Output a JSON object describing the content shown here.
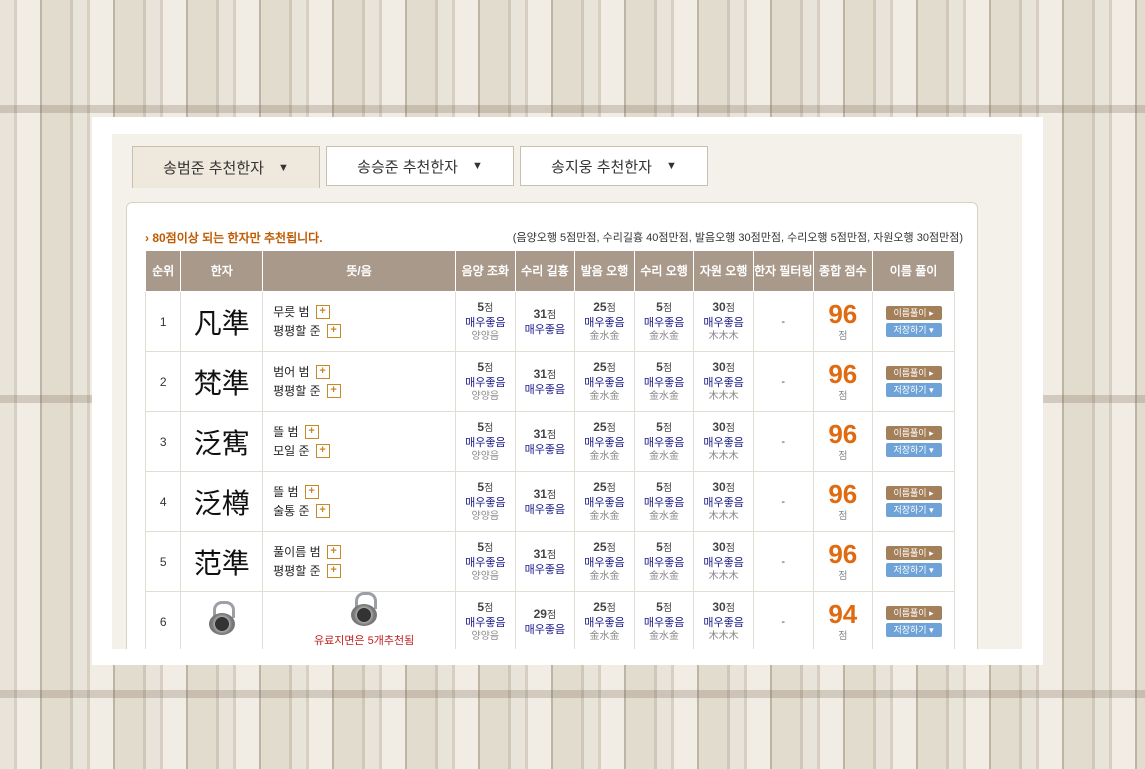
{
  "tabs": [
    {
      "label": "송범준 추천한자",
      "active": true
    },
    {
      "label": "송승준 추천한자",
      "active": false
    },
    {
      "label": "송지웅 추천한자",
      "active": false
    }
  ],
  "note": "› 80점이상 되는 한자만 추천됩니다.",
  "legend": "(음양오행 5점만점, 수리길흉 40점만점, 발음오행 30점만점, 수리오행 5점만점, 자원오행 30점만점)",
  "headers": {
    "rank": "순위",
    "hanja": "한자",
    "meaning": "뜻/음",
    "h1": "음양 조화",
    "h2": "수리 길흉",
    "h3": "발음 오행",
    "h4": "수리 오행",
    "h5": "자원 오행",
    "h6": "한자 필터링",
    "h7": "종합 점수",
    "h8": "이름 풀이"
  },
  "unit": "점",
  "grade": "매우좋음",
  "btn_interpret": "이름풀이 ▸",
  "btn_save": "저장하기 ▾",
  "rows": [
    {
      "rank": "1",
      "hanja": "凡準",
      "m1": "무릇 범",
      "m2": "평평할 준",
      "s1": "5",
      "s1sub": "양양음",
      "s2": "31",
      "s3": "25",
      "s3sub": "金水金",
      "s4": "5",
      "s4sub": "金水金",
      "s5": "30",
      "s5sub": "木木木",
      "filter": "-",
      "total": "96"
    },
    {
      "rank": "2",
      "hanja": "梵準",
      "m1": "범어 범",
      "m2": "평평할 준",
      "s1": "5",
      "s1sub": "양양음",
      "s2": "31",
      "s3": "25",
      "s3sub": "金水金",
      "s4": "5",
      "s4sub": "金水金",
      "s5": "30",
      "s5sub": "木木木",
      "filter": "-",
      "total": "96"
    },
    {
      "rank": "3",
      "hanja": "泛寯",
      "m1": "뜰 범",
      "m2": "모일 준",
      "s1": "5",
      "s1sub": "양양음",
      "s2": "31",
      "s3": "25",
      "s3sub": "金水金",
      "s4": "5",
      "s4sub": "金水金",
      "s5": "30",
      "s5sub": "木木木",
      "filter": "-",
      "total": "96"
    },
    {
      "rank": "4",
      "hanja": "泛樽",
      "m1": "뜰 범",
      "m2": "술통 준",
      "s1": "5",
      "s1sub": "양양음",
      "s2": "31",
      "s3": "25",
      "s3sub": "金水金",
      "s4": "5",
      "s4sub": "金水金",
      "s5": "30",
      "s5sub": "木木木",
      "filter": "-",
      "total": "96"
    },
    {
      "rank": "5",
      "hanja": "范準",
      "m1": "풀이름 범",
      "m2": "평평할 준",
      "s1": "5",
      "s1sub": "양양음",
      "s2": "31",
      "s3": "25",
      "s3sub": "金水金",
      "s4": "5",
      "s4sub": "金水金",
      "s5": "30",
      "s5sub": "木木木",
      "filter": "-",
      "total": "96"
    },
    {
      "rank": "6",
      "hanja": "",
      "m1": "",
      "m2": "",
      "locked": "유료지면은 5개추천됨",
      "s1": "5",
      "s1sub": "양양음",
      "s2": "29",
      "s3": "25",
      "s3sub": "金水金",
      "s4": "5",
      "s4sub": "金水金",
      "s5": "30",
      "s5sub": "木木木",
      "filter": "-",
      "total": "94"
    }
  ]
}
